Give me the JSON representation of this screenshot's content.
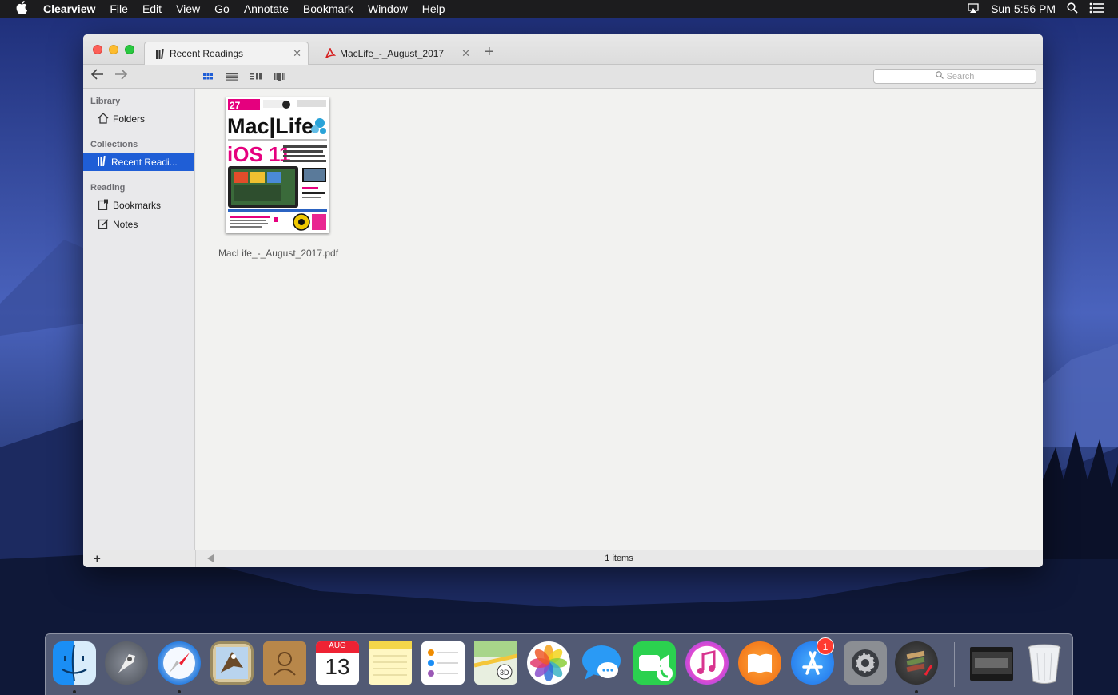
{
  "menubar": {
    "app_name": "Clearview",
    "items": [
      "File",
      "Edit",
      "View",
      "Go",
      "Annotate",
      "Bookmark",
      "Window",
      "Help"
    ],
    "clock": "Sun 5:56 PM"
  },
  "window": {
    "tabs": [
      {
        "label": "Recent Readings",
        "active": true
      },
      {
        "label": "MacLife_-_August_2017",
        "active": false
      }
    ],
    "search_placeholder": "Search"
  },
  "sidebar": {
    "sections": [
      {
        "title": "Library",
        "items": [
          "Folders"
        ]
      },
      {
        "title": "Collections",
        "items": [
          "Recent Readi..."
        ]
      },
      {
        "title": "Reading",
        "items": [
          "Bookmarks",
          "Notes"
        ]
      }
    ],
    "add_label": "+"
  },
  "content": {
    "items": [
      {
        "filename": "MacLife_-_August_2017.pdf"
      }
    ],
    "cover": {
      "brand": "Mac|Life",
      "headline": "iOS 11",
      "issue_number": "27"
    }
  },
  "status": {
    "count_text": "1 items"
  },
  "dock": {
    "calendar_month": "AUG",
    "calendar_day": "13",
    "appstore_badge": "1",
    "icons": [
      "finder-icon",
      "launchpad-icon",
      "safari-icon",
      "mail-icon",
      "contacts-icon",
      "calendar-icon",
      "notes-icon",
      "reminders-icon",
      "maps-icon",
      "photos-icon",
      "messages-icon",
      "facetime-icon",
      "itunes-icon",
      "ibooks-icon",
      "app-store-icon",
      "system-preferences-icon",
      "clearview-icon",
      "downloads-stack-icon",
      "trash-icon"
    ]
  },
  "colors": {
    "selection": "#1f5ed6",
    "accent_cover": "#e5007e"
  }
}
